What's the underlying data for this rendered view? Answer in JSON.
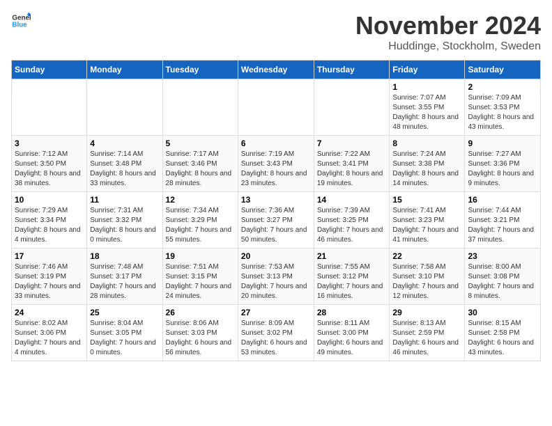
{
  "header": {
    "logo": {
      "text_general": "General",
      "text_blue": "Blue"
    },
    "month": "November 2024",
    "location": "Huddinge, Stockholm, Sweden"
  },
  "weekdays": [
    "Sunday",
    "Monday",
    "Tuesday",
    "Wednesday",
    "Thursday",
    "Friday",
    "Saturday"
  ],
  "weeks": [
    [
      {
        "day": "",
        "info": ""
      },
      {
        "day": "",
        "info": ""
      },
      {
        "day": "",
        "info": ""
      },
      {
        "day": "",
        "info": ""
      },
      {
        "day": "",
        "info": ""
      },
      {
        "day": "1",
        "info": "Sunrise: 7:07 AM\nSunset: 3:55 PM\nDaylight: 8 hours and 48 minutes."
      },
      {
        "day": "2",
        "info": "Sunrise: 7:09 AM\nSunset: 3:53 PM\nDaylight: 8 hours and 43 minutes."
      }
    ],
    [
      {
        "day": "3",
        "info": "Sunrise: 7:12 AM\nSunset: 3:50 PM\nDaylight: 8 hours and 38 minutes."
      },
      {
        "day": "4",
        "info": "Sunrise: 7:14 AM\nSunset: 3:48 PM\nDaylight: 8 hours and 33 minutes."
      },
      {
        "day": "5",
        "info": "Sunrise: 7:17 AM\nSunset: 3:46 PM\nDaylight: 8 hours and 28 minutes."
      },
      {
        "day": "6",
        "info": "Sunrise: 7:19 AM\nSunset: 3:43 PM\nDaylight: 8 hours and 23 minutes."
      },
      {
        "day": "7",
        "info": "Sunrise: 7:22 AM\nSunset: 3:41 PM\nDaylight: 8 hours and 19 minutes."
      },
      {
        "day": "8",
        "info": "Sunrise: 7:24 AM\nSunset: 3:38 PM\nDaylight: 8 hours and 14 minutes."
      },
      {
        "day": "9",
        "info": "Sunrise: 7:27 AM\nSunset: 3:36 PM\nDaylight: 8 hours and 9 minutes."
      }
    ],
    [
      {
        "day": "10",
        "info": "Sunrise: 7:29 AM\nSunset: 3:34 PM\nDaylight: 8 hours and 4 minutes."
      },
      {
        "day": "11",
        "info": "Sunrise: 7:31 AM\nSunset: 3:32 PM\nDaylight: 8 hours and 0 minutes."
      },
      {
        "day": "12",
        "info": "Sunrise: 7:34 AM\nSunset: 3:29 PM\nDaylight: 7 hours and 55 minutes."
      },
      {
        "day": "13",
        "info": "Sunrise: 7:36 AM\nSunset: 3:27 PM\nDaylight: 7 hours and 50 minutes."
      },
      {
        "day": "14",
        "info": "Sunrise: 7:39 AM\nSunset: 3:25 PM\nDaylight: 7 hours and 46 minutes."
      },
      {
        "day": "15",
        "info": "Sunrise: 7:41 AM\nSunset: 3:23 PM\nDaylight: 7 hours and 41 minutes."
      },
      {
        "day": "16",
        "info": "Sunrise: 7:44 AM\nSunset: 3:21 PM\nDaylight: 7 hours and 37 minutes."
      }
    ],
    [
      {
        "day": "17",
        "info": "Sunrise: 7:46 AM\nSunset: 3:19 PM\nDaylight: 7 hours and 33 minutes."
      },
      {
        "day": "18",
        "info": "Sunrise: 7:48 AM\nSunset: 3:17 PM\nDaylight: 7 hours and 28 minutes."
      },
      {
        "day": "19",
        "info": "Sunrise: 7:51 AM\nSunset: 3:15 PM\nDaylight: 7 hours and 24 minutes."
      },
      {
        "day": "20",
        "info": "Sunrise: 7:53 AM\nSunset: 3:13 PM\nDaylight: 7 hours and 20 minutes."
      },
      {
        "day": "21",
        "info": "Sunrise: 7:55 AM\nSunset: 3:12 PM\nDaylight: 7 hours and 16 minutes."
      },
      {
        "day": "22",
        "info": "Sunrise: 7:58 AM\nSunset: 3:10 PM\nDaylight: 7 hours and 12 minutes."
      },
      {
        "day": "23",
        "info": "Sunrise: 8:00 AM\nSunset: 3:08 PM\nDaylight: 7 hours and 8 minutes."
      }
    ],
    [
      {
        "day": "24",
        "info": "Sunrise: 8:02 AM\nSunset: 3:06 PM\nDaylight: 7 hours and 4 minutes."
      },
      {
        "day": "25",
        "info": "Sunrise: 8:04 AM\nSunset: 3:05 PM\nDaylight: 7 hours and 0 minutes."
      },
      {
        "day": "26",
        "info": "Sunrise: 8:06 AM\nSunset: 3:03 PM\nDaylight: 6 hours and 56 minutes."
      },
      {
        "day": "27",
        "info": "Sunrise: 8:09 AM\nSunset: 3:02 PM\nDaylight: 6 hours and 53 minutes."
      },
      {
        "day": "28",
        "info": "Sunrise: 8:11 AM\nSunset: 3:00 PM\nDaylight: 6 hours and 49 minutes."
      },
      {
        "day": "29",
        "info": "Sunrise: 8:13 AM\nSunset: 2:59 PM\nDaylight: 6 hours and 46 minutes."
      },
      {
        "day": "30",
        "info": "Sunrise: 8:15 AM\nSunset: 2:58 PM\nDaylight: 6 hours and 43 minutes."
      }
    ]
  ]
}
